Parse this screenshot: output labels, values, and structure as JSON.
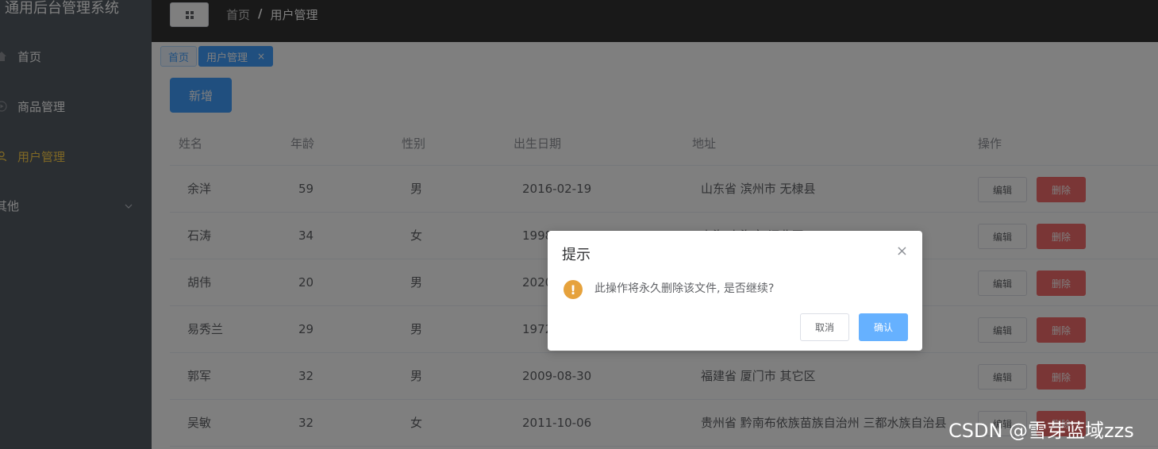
{
  "app": {
    "title": "通用后台管理系统"
  },
  "sidebar": {
    "items": [
      {
        "label": "首页",
        "icon": "home-icon"
      },
      {
        "label": "商品管理",
        "icon": "video-play-icon"
      },
      {
        "label": "用户管理",
        "icon": "user-icon",
        "active": true
      },
      {
        "label": "其他",
        "icon": "chevron-down-icon"
      }
    ]
  },
  "header": {
    "breadcrumb": {
      "home": "首页",
      "separator": "/",
      "current": "用户管理"
    }
  },
  "tags": [
    {
      "label": "首页"
    },
    {
      "label": "用户管理",
      "close": "×"
    }
  ],
  "toolbar": {
    "add_label": "新增"
  },
  "table": {
    "columns": [
      "姓名",
      "年龄",
      "性别",
      "出生日期",
      "地址",
      "操作"
    ],
    "rows": [
      {
        "name": "余洋",
        "age": "59",
        "sex": "男",
        "birth": "2016-02-19",
        "addr": "山东省 滨州市 无棣县"
      },
      {
        "name": "石涛",
        "age": "34",
        "sex": "女",
        "birth": "1998-02-12",
        "addr": "上海 上海市 闸北区"
      },
      {
        "name": "胡伟",
        "age": "20",
        "sex": "男",
        "birth": "2020-",
        "addr": ""
      },
      {
        "name": "易秀兰",
        "age": "29",
        "sex": "男",
        "birth": "1972",
        "addr": ""
      },
      {
        "name": "郭军",
        "age": "32",
        "sex": "男",
        "birth": "2009-08-30",
        "addr": "福建省 厦门市 其它区"
      },
      {
        "name": "吴敏",
        "age": "32",
        "sex": "女",
        "birth": "2011-10-06",
        "addr": "贵州省 黔南布依族苗族自治州 三都水族自治县"
      }
    ],
    "edit_label": "编辑",
    "delete_label": "删除"
  },
  "dialog": {
    "title": "提示",
    "close": "×",
    "icon": "!",
    "message": "此操作将永久删除该文件, 是否继续?",
    "cancel_label": "取消",
    "confirm_label": "确认"
  },
  "watermark": "CSDN @雪芽蓝域zzs",
  "colors": {
    "sidebar": "#545c64",
    "active": "#ffd04b",
    "primary": "#409eff",
    "danger": "#f56c6c",
    "warning": "#e6a23c"
  }
}
